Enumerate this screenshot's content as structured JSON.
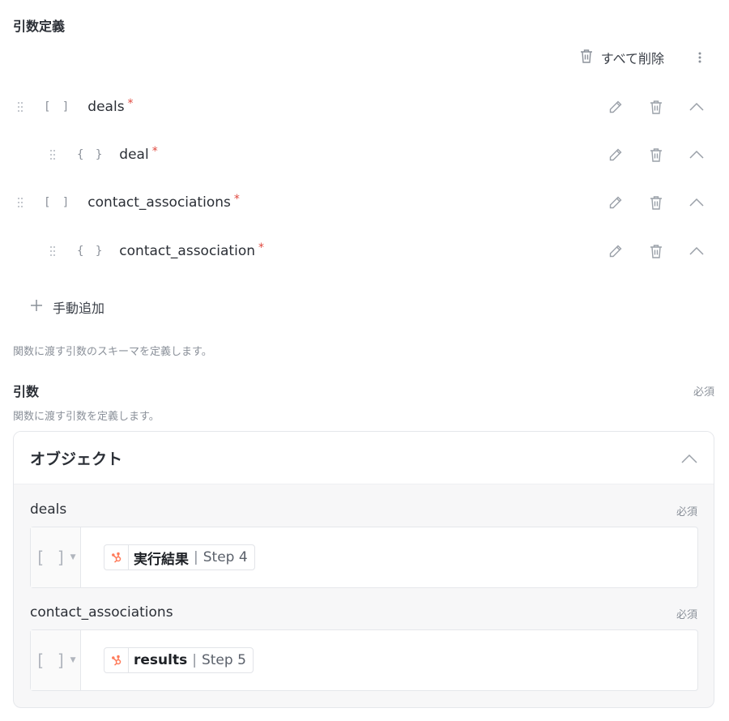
{
  "section_title": "引数定義",
  "toolbar": {
    "delete_all_label": "すべて削除",
    "trash_icon": "trash-icon",
    "more_icon": "kebab-menu-icon"
  },
  "arguments": [
    {
      "type_glyph": "[ ]",
      "name": "deals",
      "required_mark": "*",
      "level": 0
    },
    {
      "type_glyph": "{ }",
      "name": "deal",
      "required_mark": "*",
      "level": 1
    },
    {
      "type_glyph": "[ ]",
      "name": "contact_associations",
      "required_mark": "*",
      "level": 0
    },
    {
      "type_glyph": "{ }",
      "name": "contact_association",
      "required_mark": "*",
      "level": 1
    }
  ],
  "add_manual_label": "手動追加",
  "schema_description": "関数に渡す引数のスキーマを定義します。",
  "args_section": {
    "label": "引数",
    "required_label": "必須",
    "description": "関数に渡す引数を定義します。",
    "card_title": "オブジェクト",
    "fields": [
      {
        "label": "deals",
        "required_label": "必須",
        "type_glyph": "[ ]",
        "chip_main": "実行結果",
        "chip_sep": "|",
        "chip_step": "Step 4"
      },
      {
        "label": "contact_associations",
        "required_label": "必須",
        "type_glyph": "[ ]",
        "chip_main": "results",
        "chip_sep": "|",
        "chip_step": "Step 5"
      }
    ]
  },
  "colors": {
    "required_star": "#e0483e",
    "hubspot_orange": "#ff7a59",
    "muted_text": "#8a9099",
    "icon_gray": "#9aa0a8"
  }
}
